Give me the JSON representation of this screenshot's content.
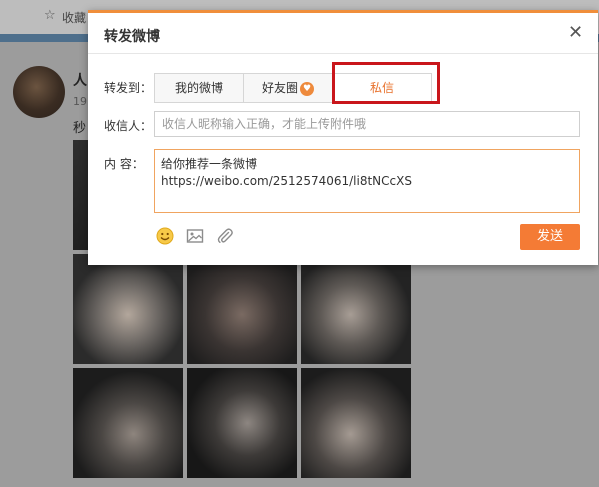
{
  "background": {
    "topbar": {
      "favorites_label": "收藏"
    },
    "post": {
      "author": "人",
      "time": "19",
      "text": "秒"
    }
  },
  "dialog": {
    "title": "转发微博",
    "close_icon": "close-icon",
    "forward_to_label": "转发到：",
    "tabs": [
      {
        "label": "我的微博"
      },
      {
        "label": "好友圈"
      },
      {
        "label": "私信",
        "selected": true
      }
    ],
    "recipient": {
      "label": "收信人：",
      "placeholder": "收信人昵称输入正确，才能上传附件哦"
    },
    "content": {
      "label": "内  容：",
      "lines": [
        "给你推荐一条微博",
        "https://weibo.com/2512574061/li8tNCcXS"
      ]
    },
    "toolbar": {
      "icons": [
        "emoji-icon",
        "image-icon",
        "attachment-icon"
      ],
      "send_label": "发送"
    },
    "colors": {
      "accent": "#f47b35",
      "highlight": "#c9161b"
    }
  }
}
